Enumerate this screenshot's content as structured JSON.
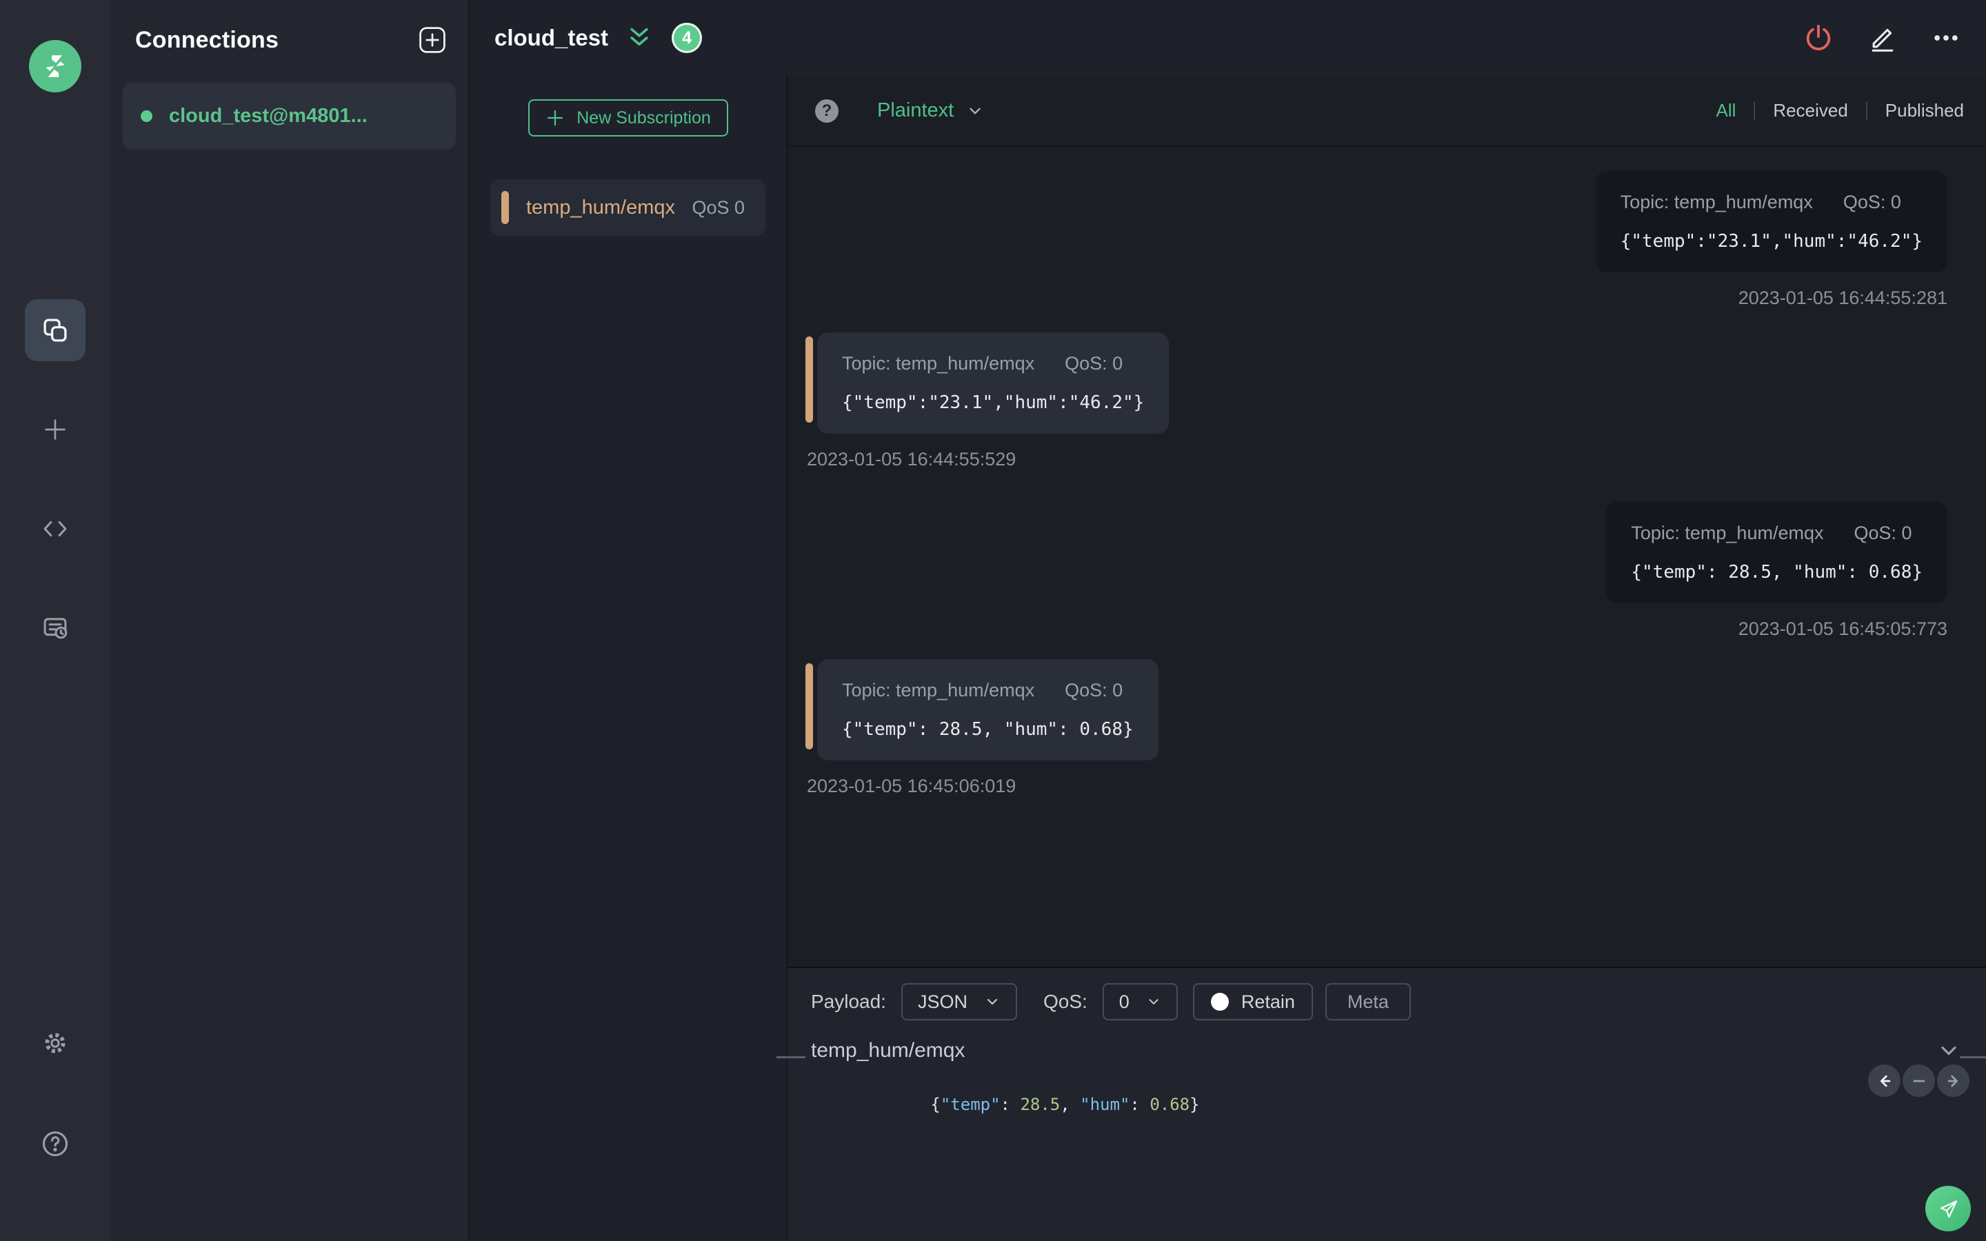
{
  "colors": {
    "accent_green": "#4fc08a",
    "badge_green": "#5ecb8e",
    "danger_red": "#e0645e",
    "topic_tan": "#d9ad80",
    "syntax_key_blue": "#7fbde8",
    "syntax_number_green": "#aec98a"
  },
  "sidebar": {
    "icons": [
      "mqttx-logo",
      "connections",
      "new-connection",
      "script",
      "log",
      "settings",
      "help"
    ]
  },
  "connections_panel": {
    "title": "Connections",
    "items": [
      {
        "name": "cloud_test@m4801...",
        "status": "connected"
      }
    ]
  },
  "header": {
    "connection_name": "cloud_test",
    "unread_count": "4"
  },
  "subscriptions": {
    "new_subscription_label": "New Subscription",
    "items": [
      {
        "topic": "temp_hum/emqx",
        "qos": "QoS 0"
      }
    ]
  },
  "message_toolbar": {
    "format_selected": "Plaintext",
    "filters": {
      "all": "All",
      "received": "Received",
      "published": "Published"
    },
    "active_filter": "All"
  },
  "messages": [
    {
      "side": "right",
      "topic_label": "Topic: temp_hum/emqx",
      "qos_label": "QoS: 0",
      "payload": "{\"temp\":\"23.1\",\"hum\":\"46.2\"}",
      "timestamp": "2023-01-05 16:44:55:281"
    },
    {
      "side": "left",
      "topic_label": "Topic: temp_hum/emqx",
      "qos_label": "QoS: 0",
      "payload": "{\"temp\":\"23.1\",\"hum\":\"46.2\"}",
      "timestamp": "2023-01-05 16:44:55:529"
    },
    {
      "side": "right",
      "topic_label": "Topic: temp_hum/emqx",
      "qos_label": "QoS: 0",
      "payload": "{\"temp\": 28.5, \"hum\": 0.68}",
      "timestamp": "2023-01-05 16:45:05:773"
    },
    {
      "side": "left",
      "topic_label": "Topic: temp_hum/emqx",
      "qos_label": "QoS: 0",
      "payload": "{\"temp\": 28.5, \"hum\": 0.68}",
      "timestamp": "2023-01-05 16:45:06:019"
    }
  ],
  "publish": {
    "payload_label": "Payload:",
    "format_value": "JSON",
    "qos_label": "QoS:",
    "qos_value": "0",
    "retain_label": "Retain",
    "meta_label": "Meta",
    "topic_value": "temp_hum/emqx",
    "editor_tokens": {
      "t0": "{",
      "t1": "\"temp\"",
      "t2": ": ",
      "t3": "28.5",
      "t4": ", ",
      "t5": "\"hum\"",
      "t6": ": ",
      "t7": "0.68",
      "t8": "}"
    }
  }
}
